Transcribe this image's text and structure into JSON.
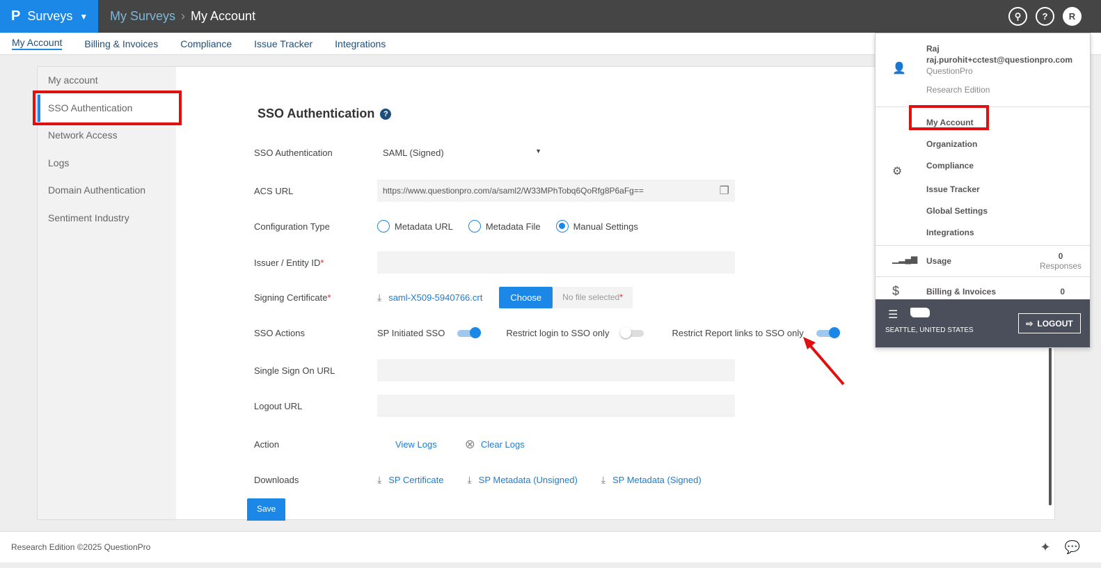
{
  "header": {
    "brand": "Surveys",
    "breadcrumb": [
      "My Surveys",
      "My Account"
    ],
    "avatar": "R"
  },
  "subnav": [
    "My Account",
    "Billing & Invoices",
    "Compliance",
    "Issue Tracker",
    "Integrations"
  ],
  "sidebar": [
    "My account",
    "SSO Authentication",
    "Network Access",
    "Logs",
    "Domain Authentication",
    "Sentiment Industry"
  ],
  "form": {
    "title": "SSO Authentication",
    "sso_label": "SSO Authentication",
    "sso_value": "SAML (Signed)",
    "acs_label": "ACS URL",
    "acs_value": "https://www.questionpro.com/a/saml2/W33MPhTobq6QoRfg8P6aFg==",
    "config_label": "Configuration Type",
    "config_options": [
      "Metadata URL",
      "Metadata File",
      "Manual Settings"
    ],
    "config_selected": "Manual Settings",
    "issuer_label": "Issuer / Entity ID",
    "issuer_value": "",
    "cert_label": "Signing Certificate",
    "cert_file": "saml-X509-5940766.crt",
    "choose": "Choose",
    "no_file": "No file selected",
    "actions_label": "SSO Actions",
    "sp_initiated": "SP Initiated SSO",
    "sp_initiated_on": true,
    "restrict_login": "Restrict login to SSO only",
    "restrict_login_on": false,
    "restrict_report": "Restrict Report links to SSO only",
    "restrict_report_on": true,
    "sso_url_label": "Single Sign On URL",
    "logout_url_label": "Logout URL",
    "action_label": "Action",
    "view_logs": "View Logs",
    "clear_logs": "Clear Logs",
    "downloads_label": "Downloads",
    "downloads": [
      "SP Certificate",
      "SP Metadata (Unsigned)",
      "SP Metadata (Signed)"
    ],
    "save": "Save"
  },
  "menu": {
    "name": "Raj",
    "email": "raj.purohit+cctest@questionpro.com",
    "company": "QuestionPro",
    "edition": "Research Edition",
    "items": [
      "My Account",
      "Organization",
      "Compliance",
      "Issue Tracker",
      "Global Settings",
      "Integrations"
    ],
    "usage": "Usage",
    "usage_count": "0",
    "usage_unit": "Responses",
    "billing": "Billing & Invoices",
    "billing_count": "0",
    "location": "SEATTLE, UNITED STATES",
    "logout": "LOGOUT"
  },
  "footer": "Research Edition ©2025 QuestionPro"
}
